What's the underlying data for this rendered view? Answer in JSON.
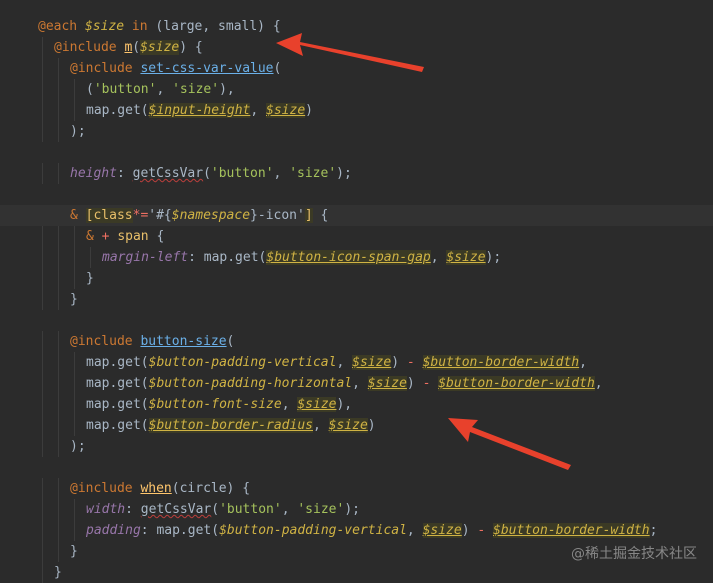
{
  "watermark": "@稀土掘金技术社区",
  "colors": {
    "background": "#2b2b2b",
    "keyword": "#cc7832",
    "variable": "#d0b344",
    "function": "#ffc66d",
    "string": "#a5c25c",
    "property": "#9876aa",
    "operator": "#ef6f62",
    "annotation_arrow": "#e8412c"
  },
  "code_lines": [
    {
      "indent": 0,
      "tokens": [
        {
          "t": "@each ",
          "c": "kw"
        },
        {
          "t": "$size",
          "c": "var"
        },
        {
          "t": " in ",
          "c": "kw"
        },
        {
          "t": "(large, small) {",
          "c": "punc"
        }
      ]
    },
    {
      "indent": 1,
      "tokens": [
        {
          "t": "@include ",
          "c": "kw"
        },
        {
          "t": "m",
          "c": "fn",
          "s": "u"
        },
        {
          "t": "(",
          "c": "punc"
        },
        {
          "t": "$size",
          "c": "var",
          "s": "hl"
        },
        {
          "t": ") {",
          "c": "punc"
        }
      ]
    },
    {
      "indent": 2,
      "tokens": [
        {
          "t": "@include ",
          "c": "kw"
        },
        {
          "t": "set-css-var-value",
          "c": "link"
        },
        {
          "t": "(",
          "c": "punc"
        }
      ]
    },
    {
      "indent": 3,
      "tokens": [
        {
          "t": "(",
          "c": "punc"
        },
        {
          "t": "'button'",
          "c": "str"
        },
        {
          "t": ", ",
          "c": "punc"
        },
        {
          "t": "'size'",
          "c": "str"
        },
        {
          "t": "),",
          "c": "punc"
        }
      ]
    },
    {
      "indent": 3,
      "tokens": [
        {
          "t": "map.get(",
          "c": "id"
        },
        {
          "t": "$input-height",
          "c": "var",
          "s": "hl u"
        },
        {
          "t": ", ",
          "c": "punc"
        },
        {
          "t": "$size",
          "c": "var",
          "s": "hl u"
        },
        {
          "t": ")",
          "c": "punc"
        }
      ]
    },
    {
      "indent": 2,
      "tokens": [
        {
          "t": ");",
          "c": "punc"
        }
      ]
    },
    {
      "indent": 0,
      "tokens": []
    },
    {
      "indent": 2,
      "tokens": [
        {
          "t": "height",
          "c": "prop"
        },
        {
          "t": ": ",
          "c": "punc"
        },
        {
          "t": "getCssVar",
          "c": "id",
          "s": "squiggle"
        },
        {
          "t": "(",
          "c": "punc"
        },
        {
          "t": "'button'",
          "c": "str"
        },
        {
          "t": ", ",
          "c": "punc"
        },
        {
          "t": "'size'",
          "c": "str"
        },
        {
          "t": ");",
          "c": "punc"
        }
      ]
    },
    {
      "indent": 0,
      "tokens": []
    },
    {
      "indent": 2,
      "current": true,
      "tokens": [
        {
          "t": "& ",
          "c": "kw"
        },
        {
          "t": "[",
          "c": "sel",
          "s": "hl"
        },
        {
          "t": "class",
          "c": "sel",
          "s": "hl"
        },
        {
          "t": "*=",
          "c": "op"
        },
        {
          "t": "'#{",
          "c": "punc"
        },
        {
          "t": "$namespace",
          "c": "var"
        },
        {
          "t": "}-icon'",
          "c": "punc"
        },
        {
          "t": "]",
          "c": "sel",
          "s": "hl"
        },
        {
          "t": " {",
          "c": "punc"
        }
      ]
    },
    {
      "indent": 3,
      "tokens": [
        {
          "t": "& ",
          "c": "kw"
        },
        {
          "t": "+ ",
          "c": "op"
        },
        {
          "t": "span",
          "c": "sel"
        },
        {
          "t": " {",
          "c": "punc"
        }
      ]
    },
    {
      "indent": 4,
      "tokens": [
        {
          "t": "margin-left",
          "c": "prop"
        },
        {
          "t": ": map.get(",
          "c": "id"
        },
        {
          "t": "$button-icon-span-gap",
          "c": "var",
          "s": "hl u"
        },
        {
          "t": ", ",
          "c": "punc"
        },
        {
          "t": "$size",
          "c": "var",
          "s": "hl u"
        },
        {
          "t": ");",
          "c": "punc"
        }
      ]
    },
    {
      "indent": 3,
      "tokens": [
        {
          "t": "}",
          "c": "punc"
        }
      ]
    },
    {
      "indent": 2,
      "tokens": [
        {
          "t": "}",
          "c": "punc"
        }
      ]
    },
    {
      "indent": 0,
      "tokens": []
    },
    {
      "indent": 2,
      "tokens": [
        {
          "t": "@include ",
          "c": "kw"
        },
        {
          "t": "button-size",
          "c": "link"
        },
        {
          "t": "(",
          "c": "punc"
        }
      ]
    },
    {
      "indent": 3,
      "tokens": [
        {
          "t": "map.get(",
          "c": "id"
        },
        {
          "t": "$button-padding-vertical",
          "c": "var"
        },
        {
          "t": ", ",
          "c": "punc"
        },
        {
          "t": "$size",
          "c": "var",
          "s": "hl u"
        },
        {
          "t": ") ",
          "c": "punc"
        },
        {
          "t": "- ",
          "c": "op"
        },
        {
          "t": "$button-border-width",
          "c": "var",
          "s": "hl u"
        },
        {
          "t": ",",
          "c": "punc"
        }
      ]
    },
    {
      "indent": 3,
      "tokens": [
        {
          "t": "map.get(",
          "c": "id"
        },
        {
          "t": "$button-padding-horizontal",
          "c": "var"
        },
        {
          "t": ", ",
          "c": "punc"
        },
        {
          "t": "$size",
          "c": "var",
          "s": "hl u"
        },
        {
          "t": ") ",
          "c": "punc"
        },
        {
          "t": "- ",
          "c": "op"
        },
        {
          "t": "$button-border-width",
          "c": "var",
          "s": "hl u"
        },
        {
          "t": ",",
          "c": "punc"
        }
      ]
    },
    {
      "indent": 3,
      "tokens": [
        {
          "t": "map.get(",
          "c": "id"
        },
        {
          "t": "$button-font-size",
          "c": "var"
        },
        {
          "t": ", ",
          "c": "punc"
        },
        {
          "t": "$size",
          "c": "var",
          "s": "hl u"
        },
        {
          "t": "),",
          "c": "punc"
        }
      ]
    },
    {
      "indent": 3,
      "tokens": [
        {
          "t": "map.get(",
          "c": "id"
        },
        {
          "t": "$button-border-radius",
          "c": "var",
          "s": "hl u"
        },
        {
          "t": ", ",
          "c": "punc"
        },
        {
          "t": "$size",
          "c": "var",
          "s": "hl u"
        },
        {
          "t": ")",
          "c": "punc"
        }
      ]
    },
    {
      "indent": 2,
      "tokens": [
        {
          "t": ");",
          "c": "punc"
        }
      ]
    },
    {
      "indent": 0,
      "tokens": []
    },
    {
      "indent": 2,
      "tokens": [
        {
          "t": "@include ",
          "c": "kw"
        },
        {
          "t": "when",
          "c": "fn",
          "s": "u"
        },
        {
          "t": "(circle) {",
          "c": "punc"
        }
      ]
    },
    {
      "indent": 3,
      "tokens": [
        {
          "t": "width",
          "c": "prop"
        },
        {
          "t": ": ",
          "c": "punc"
        },
        {
          "t": "getCssVar",
          "c": "id",
          "s": "squiggle"
        },
        {
          "t": "(",
          "c": "punc"
        },
        {
          "t": "'button'",
          "c": "str"
        },
        {
          "t": ", ",
          "c": "punc"
        },
        {
          "t": "'size'",
          "c": "str"
        },
        {
          "t": ");",
          "c": "punc"
        }
      ]
    },
    {
      "indent": 3,
      "tokens": [
        {
          "t": "padding",
          "c": "prop"
        },
        {
          "t": ": map.get(",
          "c": "id"
        },
        {
          "t": "$button-padding-vertical",
          "c": "var"
        },
        {
          "t": ", ",
          "c": "punc"
        },
        {
          "t": "$size",
          "c": "var",
          "s": "hl u"
        },
        {
          "t": ") ",
          "c": "punc"
        },
        {
          "t": "- ",
          "c": "op"
        },
        {
          "t": "$button-border-width",
          "c": "var",
          "s": "hl u"
        },
        {
          "t": ";",
          "c": "punc"
        }
      ]
    },
    {
      "indent": 2,
      "tokens": [
        {
          "t": "}",
          "c": "punc"
        }
      ]
    },
    {
      "indent": 1,
      "tokens": [
        {
          "t": "}",
          "c": "punc"
        }
      ]
    }
  ]
}
